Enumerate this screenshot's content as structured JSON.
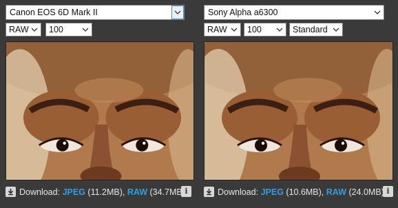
{
  "left": {
    "camera": "Canon EOS 6D Mark II",
    "format": "RAW",
    "iso": "100",
    "download": {
      "prefix": "Download:",
      "jpeg_label": "JPEG",
      "jpeg_size": "(11.2MB),",
      "raw_label": "RAW",
      "raw_size": "(34.7MB)"
    }
  },
  "right": {
    "camera": "Sony Alpha a6300",
    "format": "RAW",
    "iso": "100",
    "mode": "Standard",
    "download": {
      "prefix": "Download:",
      "jpeg_label": "JPEG",
      "jpeg_size": "(10.6MB),",
      "raw_label": "RAW",
      "raw_size": "(24.0MB)"
    }
  },
  "icons": {
    "chevron": "chevron-down-icon",
    "download": "download-icon",
    "info": "info-icon"
  },
  "colors": {
    "background": "#3a3a3a",
    "link": "#2f9fe0"
  }
}
